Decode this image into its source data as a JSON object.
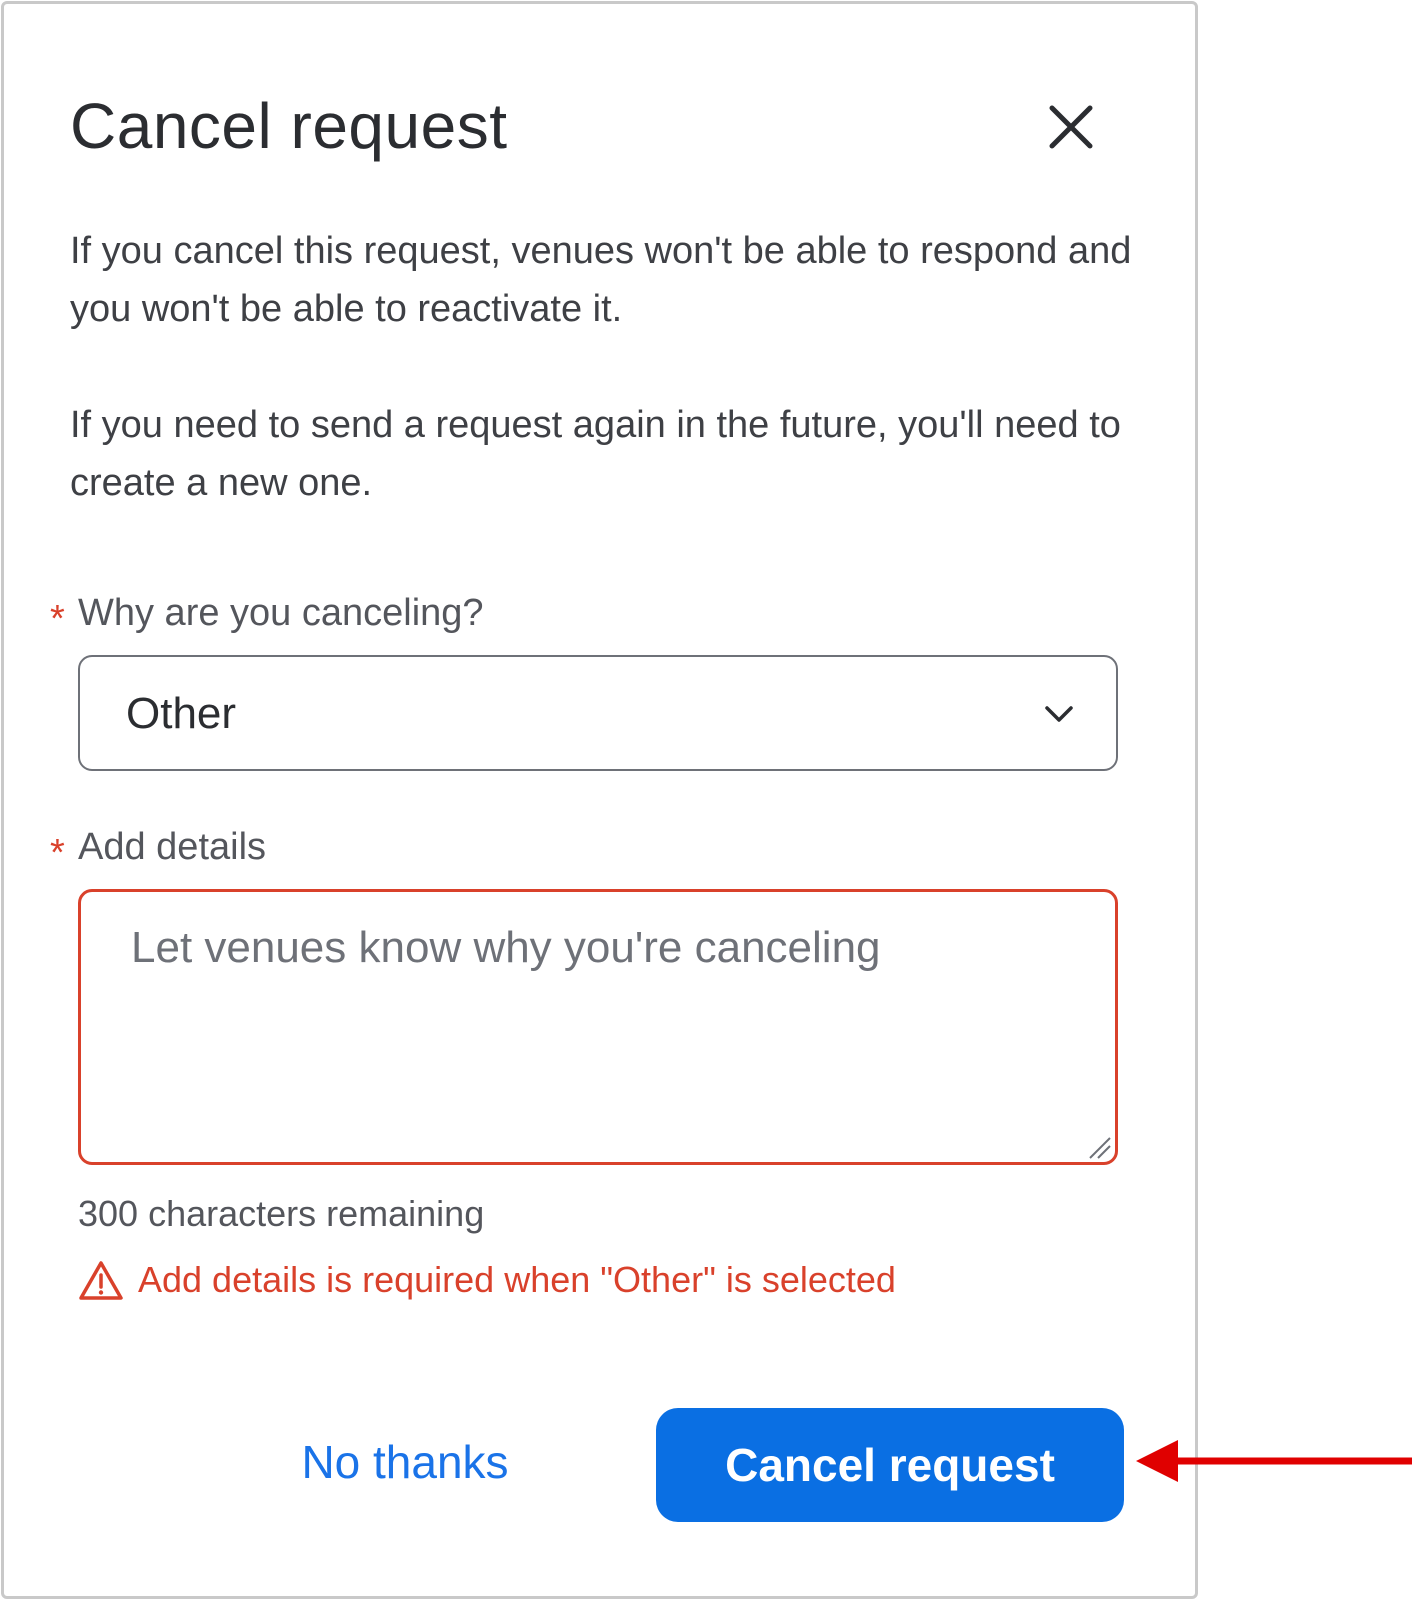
{
  "dialog": {
    "title": "Cancel request",
    "close_icon": "close-icon",
    "paragraphs": [
      "If you cancel this request, venues won't be able to respond and you won't be able to reactivate it.",
      "If you need to send a request again in the future, you'll need to create a new one."
    ],
    "reason": {
      "required_marker": "*",
      "label": "Why are you canceling?",
      "selected_value": "Other",
      "icon": "chevron-down-icon"
    },
    "details": {
      "required_marker": "*",
      "label": "Add details",
      "value": "",
      "placeholder": "Let venues know why you're canceling",
      "counter": "300 characters remaining",
      "error_icon": "warning-icon",
      "error": "Add details is required when \"Other\" is selected"
    },
    "actions": {
      "secondary_label": "No thanks",
      "primary_label": "Cancel request"
    }
  },
  "annotation": {
    "icon": "arrow-left-icon"
  },
  "colors": {
    "primary": "#0a6fe3",
    "link": "#1a73e8",
    "error": "#d9412b",
    "annotation_arrow": "#e00000"
  }
}
